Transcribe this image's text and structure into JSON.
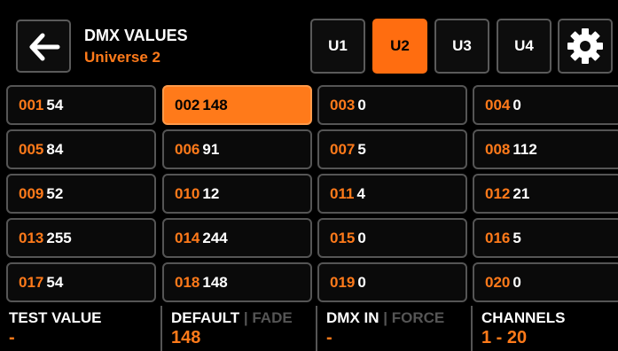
{
  "header": {
    "title": "DMX VALUES",
    "subtitle": "Universe 2"
  },
  "universes": [
    {
      "label": "U1",
      "active": false
    },
    {
      "label": "U2",
      "active": true
    },
    {
      "label": "U3",
      "active": false
    },
    {
      "label": "U4",
      "active": false
    }
  ],
  "channels": [
    {
      "ch": "001",
      "val": "54"
    },
    {
      "ch": "002",
      "val": "148",
      "active": true
    },
    {
      "ch": "003",
      "val": "0"
    },
    {
      "ch": "004",
      "val": "0"
    },
    {
      "ch": "005",
      "val": "84"
    },
    {
      "ch": "006",
      "val": "91"
    },
    {
      "ch": "007",
      "val": "5"
    },
    {
      "ch": "008",
      "val": "112"
    },
    {
      "ch": "009",
      "val": "52"
    },
    {
      "ch": "010",
      "val": "12"
    },
    {
      "ch": "011",
      "val": "4"
    },
    {
      "ch": "012",
      "val": "21"
    },
    {
      "ch": "013",
      "val": "255"
    },
    {
      "ch": "014",
      "val": "244"
    },
    {
      "ch": "015",
      "val": "0"
    },
    {
      "ch": "016",
      "val": "5"
    },
    {
      "ch": "017",
      "val": "54"
    },
    {
      "ch": "018",
      "val": "148"
    },
    {
      "ch": "019",
      "val": "0"
    },
    {
      "ch": "020",
      "val": "0"
    }
  ],
  "footer": {
    "test": {
      "label": "TEST VALUE",
      "value": "-"
    },
    "default": {
      "label": "DEFAULT",
      "alt": "FADE",
      "value": "148"
    },
    "dmxin": {
      "label": "DMX IN",
      "alt": "FORCE",
      "value": "-"
    },
    "channels": {
      "label": "CHANNELS",
      "value": "1 - 20"
    }
  },
  "colors": {
    "accent": "#ff7a1a",
    "border": "#555555",
    "background": "#000000"
  },
  "icons": {
    "back": "arrow-left-icon",
    "settings": "gear-icon"
  }
}
